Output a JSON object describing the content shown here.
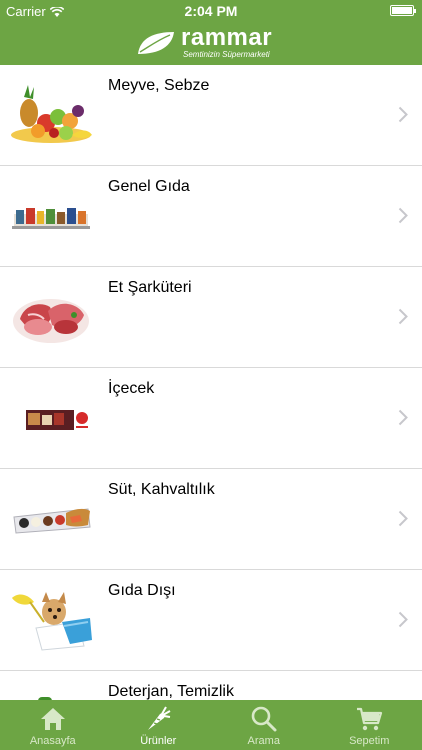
{
  "status_bar": {
    "carrier": "Carrier",
    "time": "2:04 PM"
  },
  "header": {
    "brand": "rammar",
    "tagline": "Semtinizin Süpermarketi"
  },
  "categories": [
    {
      "label": "Meyve, Sebze",
      "icon": "fruits-vegetables-image"
    },
    {
      "label": "Genel Gıda",
      "icon": "grocery-products-image"
    },
    {
      "label": "Et Şarküteri",
      "icon": "meat-deli-image"
    },
    {
      "label": "İçecek",
      "icon": "drinks-image"
    },
    {
      "label": "Süt, Kahvaltılık",
      "icon": "breakfast-dairy-image"
    },
    {
      "label": "Gıda Dışı",
      "icon": "non-food-dog-image"
    },
    {
      "label": "Deterjan, Temizlik",
      "icon": "detergent-cleaning-image"
    }
  ],
  "tabs": [
    {
      "label": "Anasayfa",
      "icon": "home-icon",
      "active": false
    },
    {
      "label": "Ürünler",
      "icon": "carrot-icon",
      "active": true
    },
    {
      "label": "Arama",
      "icon": "search-icon",
      "active": false
    },
    {
      "label": "Sepetim",
      "icon": "cart-icon",
      "active": false
    }
  ],
  "colors": {
    "brand_green": "#6da544",
    "separator": "#d9d9d9",
    "chevron": "#c7c7cc"
  }
}
